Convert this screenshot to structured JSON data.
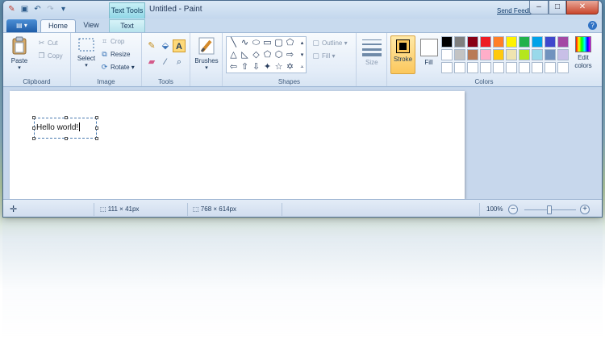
{
  "window": {
    "title": "Untitled - Paint",
    "context_tab": "Text Tools",
    "send_feedback": "Send Feedback",
    "controls": {
      "minimize": "–",
      "maximize": "□",
      "close": "✕"
    }
  },
  "qat": [
    "paint-icon",
    "save-icon",
    "undo-icon",
    "redo-icon",
    "dropdown-icon"
  ],
  "tabs": {
    "home": "Home",
    "view": "View",
    "text": "Text",
    "help": "?"
  },
  "ribbon": {
    "clipboard": {
      "label": "Clipboard",
      "paste": "Paste",
      "cut": "Cut",
      "copy": "Copy"
    },
    "image": {
      "label": "Image",
      "select": "Select",
      "crop": "Crop",
      "resize": "Resize",
      "rotate": "Rotate ▾"
    },
    "tools": {
      "label": "Tools"
    },
    "brushes": {
      "label": "Brushes"
    },
    "shapes": {
      "label": "Shapes",
      "outline": "Outline ▾",
      "fill": "Fill ▾"
    },
    "size": {
      "label": "Size"
    },
    "colors": {
      "label": "Colors",
      "stroke": "Stroke",
      "fill": "Fill",
      "edit": "Edit colors",
      "stroke_color": "#000000",
      "fill_color": "#ffffff",
      "palette_row1": [
        "#000000",
        "#7f7f7f",
        "#880015",
        "#ed1c24",
        "#ff7f27",
        "#fff200",
        "#22b14c",
        "#00a2e8",
        "#3f48cc",
        "#a349a4"
      ],
      "palette_row2": [
        "#ffffff",
        "#c3c3c3",
        "#b97a57",
        "#ffaec9",
        "#ffc90e",
        "#efe4b0",
        "#b5e61d",
        "#99d9ea",
        "#7092be",
        "#c8bfe7"
      ],
      "palette_row3": [
        "#ffffff",
        "#ffffff",
        "#ffffff",
        "#ffffff",
        "#ffffff",
        "#ffffff",
        "#ffffff",
        "#ffffff",
        "#ffffff",
        "#ffffff"
      ]
    }
  },
  "canvas": {
    "text": "Hello world!"
  },
  "status": {
    "selection_size": "111 × 41px",
    "image_size": "768 × 614px",
    "zoom": "100%",
    "zoom_out": "−",
    "zoom_in": "+"
  }
}
